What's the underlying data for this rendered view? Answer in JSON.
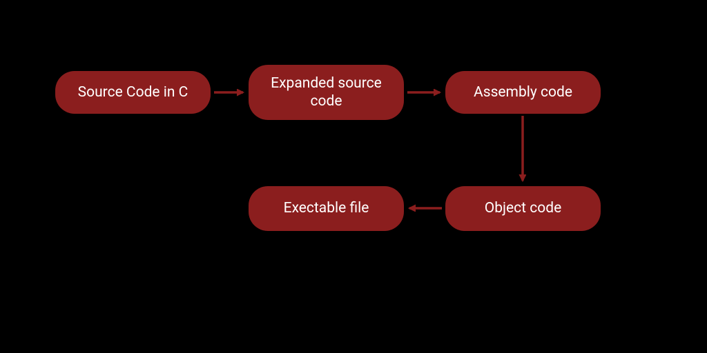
{
  "diagram": {
    "nodes": {
      "source": {
        "label": "Source Code in C"
      },
      "expanded": {
        "label": "Expanded source code"
      },
      "assembly": {
        "label": "Assembly code"
      },
      "object": {
        "label": "Object code"
      },
      "executable": {
        "label": "Exectable file"
      }
    },
    "flow": [
      [
        "source",
        "expanded"
      ],
      [
        "expanded",
        "assembly"
      ],
      [
        "assembly",
        "object"
      ],
      [
        "object",
        "executable"
      ]
    ],
    "colors": {
      "node_bg": "#8b1e1e",
      "node_fg": "#ffffff",
      "bg": "#000000",
      "arrow": "#8b1e1e"
    }
  }
}
